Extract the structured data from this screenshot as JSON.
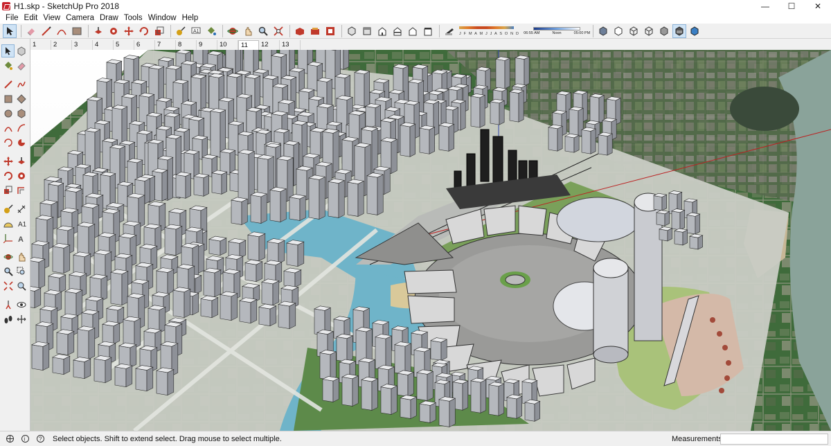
{
  "window": {
    "title": "H1.skp - SketchUp Pro 2018",
    "controls": {
      "minimize": "—",
      "maximize": "☐",
      "close": "✕"
    }
  },
  "menu": [
    "File",
    "Edit",
    "View",
    "Camera",
    "Draw",
    "Tools",
    "Window",
    "Help"
  ],
  "shadow_settings": {
    "months": "J F M A M J J A S O N D",
    "time_start": "06:55 AM",
    "time_noon": "Noon",
    "time_end": "05:00 PM"
  },
  "scene_tabs": [
    "1",
    "2",
    "3",
    "4",
    "5",
    "6",
    "7",
    "8",
    "9",
    "10",
    "11",
    "12",
    "13"
  ],
  "active_scene": "11",
  "status": {
    "message": "Select objects. Shift to extend select. Drag mouse to select multiple.",
    "measurements_label": "Measurements",
    "measurements_value": ""
  },
  "colors": {
    "accent": "#1f6fc5",
    "terrain_green": "#3f6b3b",
    "building_gray": "#9b9fa6",
    "water": "#6fb4c9"
  }
}
